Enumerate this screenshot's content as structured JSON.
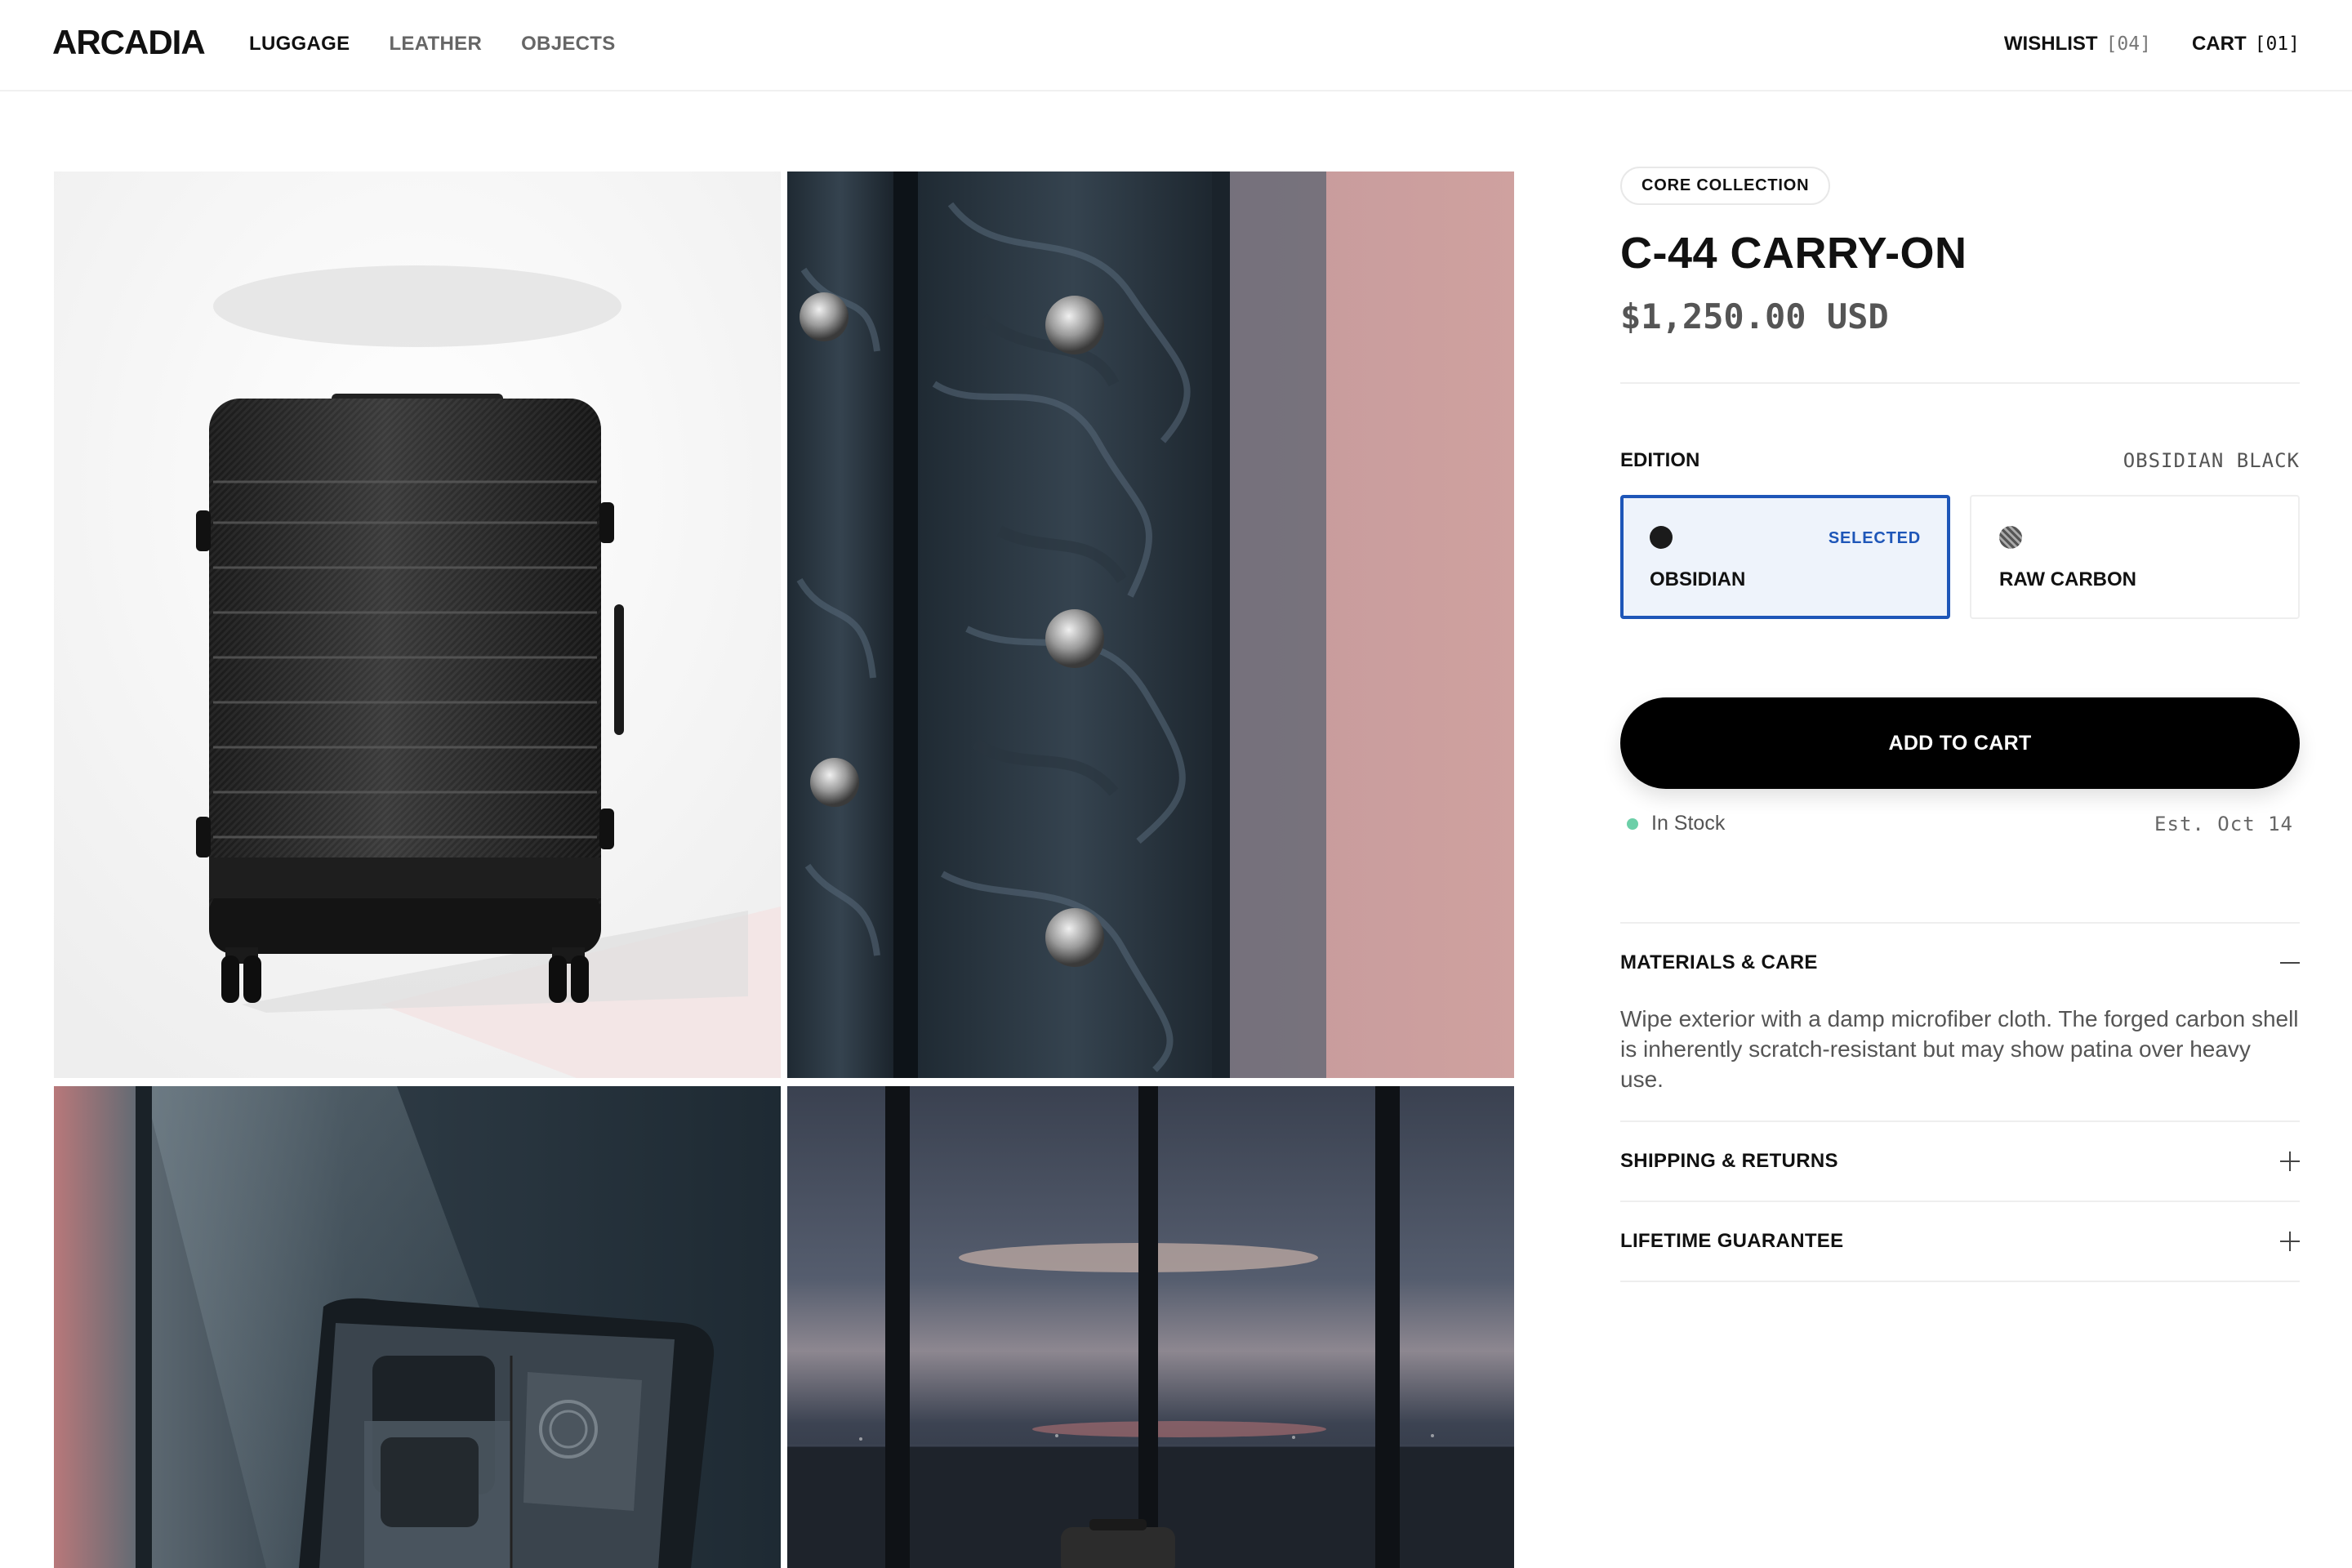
{
  "brand": {
    "logo": "ARCADIA"
  },
  "nav": {
    "items": [
      {
        "label": "LUGGAGE",
        "active": true
      },
      {
        "label": "LEATHER",
        "active": false
      },
      {
        "label": "OBJECTS",
        "active": false
      }
    ]
  },
  "header": {
    "wishlist": {
      "label": "WISHLIST",
      "count": "[04]"
    },
    "cart": {
      "label": "CART",
      "count": "[01]"
    }
  },
  "gallery": {
    "images": [
      {
        "name": "black suitcase front view"
      },
      {
        "name": "forged carbon shell close-up"
      },
      {
        "name": "open suitcase interior"
      },
      {
        "name": "suitcase at airport window at dusk"
      }
    ]
  },
  "product": {
    "collection_badge": "CORE COLLECTION",
    "title": "C-44 CARRY-ON",
    "price": "$1,250.00 USD",
    "edition": {
      "label": "EDITION",
      "current": "OBSIDIAN BLACK",
      "options": [
        {
          "name": "OBSIDIAN",
          "selected": true,
          "flag": "SELECTED",
          "color": "#1b1b1b"
        },
        {
          "name": "RAW CARBON",
          "selected": false,
          "color": "#777777"
        }
      ]
    },
    "cta_label": "ADD TO CART",
    "stock_status": "In Stock",
    "eta": "Est. Oct 14",
    "accordion": [
      {
        "title": "MATERIALS & CARE",
        "expanded": true,
        "icon": "minus-icon",
        "body": "Wipe exterior with a damp microfiber cloth. The forged carbon shell is inherently scratch-resistant but may show patina over heavy use."
      },
      {
        "title": "SHIPPING & RETURNS",
        "expanded": false,
        "icon": "plus-icon"
      },
      {
        "title": "LIFETIME GUARANTEE",
        "expanded": false,
        "icon": "plus-icon"
      }
    ]
  },
  "colors": {
    "accent": "#1e56b8",
    "cta": "#000000",
    "stock_dot": "#6ccfa8"
  }
}
